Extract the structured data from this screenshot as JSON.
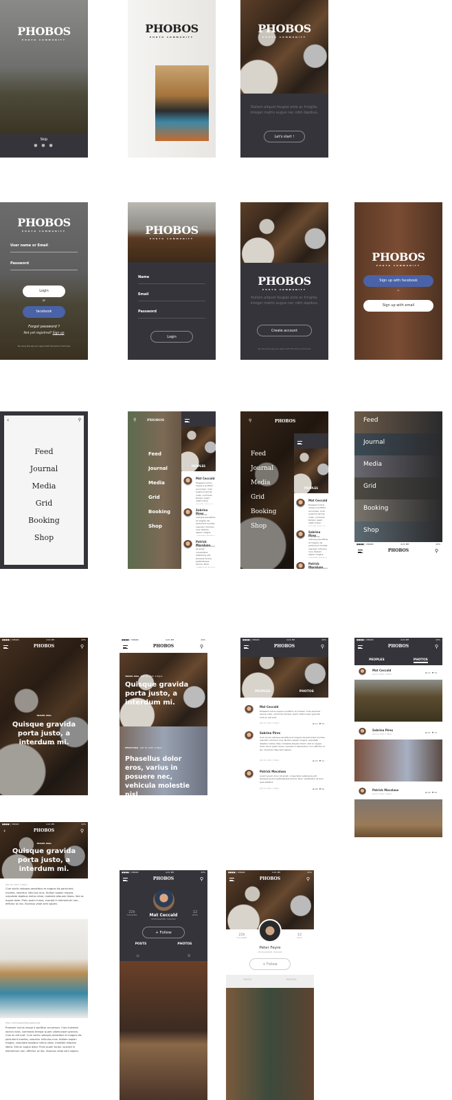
{
  "brand": {
    "name": "PHOBOS",
    "tagline": "PHOTO COMMUNITY"
  },
  "colors": {
    "dark": "#35343a",
    "facebook": "#4a63a8"
  },
  "status": {
    "carrier": "●●●●○ VIRGIN",
    "time": "4:21 PM",
    "battery": "22%"
  },
  "onboarding": {
    "skip": "Skip",
    "page_dots": "● ● ●",
    "intro_text": "Nullam aliquet feugiat ante ac fringilla. Integer mattis augue nec nibh dapibus.",
    "start_button": "Let's start !"
  },
  "login": {
    "username_label": "User name or Email",
    "password_label": "Password",
    "login_button": "Login",
    "or": "or",
    "facebook_button": "facebook",
    "forgot": "Forgot password ?",
    "not_registered": "Not yet registred?",
    "sign_up": "Sign up",
    "terms": "By using this app you agree with the terms of services"
  },
  "register": {
    "name_label": "Name",
    "email_label": "Email",
    "password_label": "Password",
    "login_button": "Login",
    "create_button": "Create account",
    "signup_facebook": "Sign up with facebook",
    "or": "or",
    "signup_email": "Sign up with email"
  },
  "menu": {
    "items": [
      "Feed",
      "Journal",
      "Media",
      "Grid",
      "Booking",
      "Shop"
    ],
    "back_icon": "chevron-left-icon",
    "search_icon": "search-icon"
  },
  "tabs": {
    "peoples": "PEOPLES",
    "photos": "PHOTOS",
    "posts": "POSTS"
  },
  "articles": [
    {
      "category": "TRAVEL MAG",
      "title": "Quisque gravida porta justo, a interdum mi.",
      "date": "JULY 14, 2015, 3:34pm"
    },
    {
      "category": "PHOTO MAG",
      "title": "Phasellus dolor eros, varius in posuere nec, vehicula molestie nisl.",
      "date": "JULY 14, 2015, 3:34pm"
    }
  ],
  "posts": [
    {
      "name": "Mat Ceccald",
      "text": "Praesent luctus neque a porttitor accumsan. Cras euismod lacinia nulla, commodo tempor quam ullamcorper gravida. Cras ac elit erat.",
      "date": "JULY 14, 2015, 3:34pm",
      "comments": "12",
      "likes": "34"
    },
    {
      "name": "Sabrina Pires",
      "text": "Cum sociis natoque penatibus et magnis dis parturient montes, nascetur ridiculus mus. Nullam sapien magna, vulputate dapibus metus vitae, molestie aliquam libero. Sed ac augue dolor. Proin quam turpis, suscipit in elementum non, efficitur ac leo. Vivamus vitae sem sapien.",
      "date": "JULY 14, 2015, 3:34pm",
      "comments": "22",
      "likes": "12"
    },
    {
      "name": "Patrick Macaluso",
      "text": "Lorem ipsum dolor sit amet, consectetur adipiscing elit. Quisque lacinia pellentesque lacinia. Nunc vestibulum at eros quis eleifend.",
      "date": "JULY 14, 2015, 3:34pm",
      "comments": "08",
      "likes": "56"
    }
  ],
  "article_detail": {
    "date": "JULY 14, 2015, 3:34pm",
    "body": "Cum sociis natoque penatibus et magnis dis parturient montes, nascetur ridiculus mus. Nullam sapien magna, vulputate dapibus metus vitae, molestie aliquam libero. Sed ac augue dolor. Proin quam turpis, suscipit in elementum non, efficitur ac leo. Vivamus vitae sem sapien.",
    "caption": "HELD, PHOTOGRAPHER/LANDSCAPE",
    "body2": "Praesent luctus neque a porttitor accumsan. Cras euismod lacinia nulla, commodo tempor quam ullamcorper gravida. Cras ac elit erat. Cum sociis natoque penatibus et magnis dis parturient montes, nascetur ridiculus mus. Nullam sapien magna, vulputate dapibus metus vitae, molestie aliquam libero. Sed ac augue dolor. Proin quam turpis, suscipit in elementum non, efficitur ac leo. Vivamus vitae sem sapien."
  },
  "profiles": [
    {
      "name": "Mat Ceccald",
      "role": "PHOTOGRAPHER, TRAVELER",
      "followers": "22k",
      "followers_label": "FOLLOWERS",
      "posts": "12",
      "posts_label": "POSTS",
      "follow": "+ Follow"
    },
    {
      "name": "Peter Feyre",
      "role": "PHOTOGRAPHER, TRAVELER",
      "followers": "22k",
      "followers_label": "FOLLOWERS",
      "posts": "12",
      "posts_label": "POSTS",
      "follow": "+ Follow"
    }
  ]
}
